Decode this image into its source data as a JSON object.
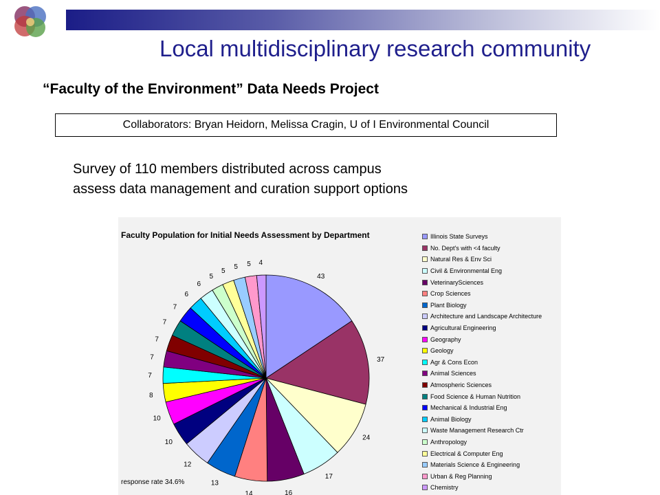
{
  "slide": {
    "title": "Local multidisciplinary research community",
    "subtitle": "“Faculty of the Environment” Data Needs Project",
    "collaborators": "Collaborators: Bryan Heidorn, Melissa Cragin, U of I Environmental Council",
    "survey_line1": "Survey of 110 members distributed across campus",
    "survey_line2": "assess data management and curation support options"
  },
  "colors": {
    "header_dark": "#1b1d87",
    "title": "#1f1f8c"
  },
  "chart_data": {
    "type": "pie",
    "title": "Faculty Population for Initial Needs Assessment by Department",
    "legend_position": "right",
    "annotation": "response rate 34.6%",
    "categories": [
      "Illinois State Surveys",
      "No. Dept's with <4 faculty",
      "Natural Res & Env Sci",
      "Civil & Environmental Eng",
      "VeterinarySciences",
      "Crop Sciences",
      "Plant Biology",
      "Architecture and Landscape Architecture",
      "Agricultural Engineering",
      "Geography",
      "Geology",
      "Agr & Cons Econ",
      "Animal Sciences",
      "Atmospheric Sciences",
      "Food Science & Human Nutrition",
      "Mechanical & Industrial Eng",
      "Animal Biology",
      "Waste Management Research Ctr",
      "Anthropology",
      "Electrical & Computer Eng",
      "Materials Science & Engineering",
      "Urban & Reg Planning",
      "Chemistry"
    ],
    "values": [
      43,
      37,
      24,
      17,
      16,
      14,
      13,
      12,
      10,
      10,
      8,
      7,
      7,
      7,
      7,
      7,
      6,
      6,
      5,
      5,
      5,
      5,
      4
    ],
    "colors": [
      "#9999ff",
      "#993366",
      "#ffffcc",
      "#ccffff",
      "#660066",
      "#ff8080",
      "#0066cc",
      "#ccccff",
      "#000080",
      "#ff00ff",
      "#ffff00",
      "#00ffff",
      "#800080",
      "#800000",
      "#008080",
      "#0000ff",
      "#00ccff",
      "#ccffff",
      "#ccffcc",
      "#ffff99",
      "#99ccff",
      "#ff99cc",
      "#cc99ff"
    ]
  }
}
